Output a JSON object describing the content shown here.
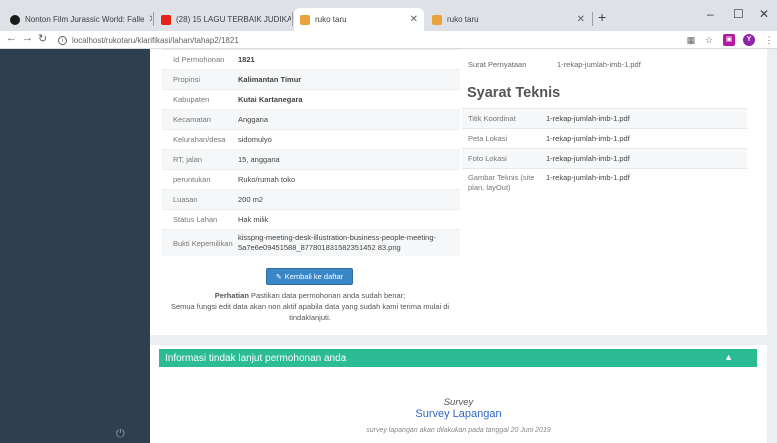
{
  "tabs": [
    {
      "title": "Nonton Film Jurassic World: Falle",
      "color": "#1a1a1a"
    },
    {
      "title": "(28) 15 LAGU TERBAIK JUDIKA",
      "color": "#e62117"
    },
    {
      "title": "ruko taru",
      "color": "#e8a33a"
    },
    {
      "title": "ruko taru",
      "color": "#e8a33a"
    }
  ],
  "window": {
    "new_tab": "+",
    "minimize": "–",
    "maximize": "☐",
    "close": "✕"
  },
  "address": {
    "url": "localhost/rukotaru/klarifikasi/lahan/tahap2/1821"
  },
  "details": [
    {
      "label": "Id Permohonan",
      "value": "1821",
      "bold": true
    },
    {
      "label": "Propinsi",
      "value": "Kalimantan Timur",
      "bold": true
    },
    {
      "label": "Kabupaten",
      "value": "Kutai Kartanegara",
      "bold": true
    },
    {
      "label": "Kecamatan",
      "value": "Anggana"
    },
    {
      "label": "Kelurahan/desa",
      "value": "sidomulyo"
    },
    {
      "label": "RT, jalan",
      "value": "15, anggana"
    },
    {
      "label": "peruntukan",
      "value": "Ruko/rumah toko"
    },
    {
      "label": "Luasan",
      "value": "200 m2"
    },
    {
      "label": "Status Lahan",
      "value": "Hak milik"
    },
    {
      "label": "Bukti Kepemilikan",
      "value": "kisspng-meeting-desk-illustration-business-people-meeting-5a7e6e09451588_877801831582351452 83.png"
    }
  ],
  "surat": {
    "label": "Surat Pernyataan",
    "value": "1-rekap-jumlah-imb-1.pdf"
  },
  "syarat_title": "Syarat Teknis",
  "syarat": [
    {
      "label": "Titik Koordinat",
      "value": "1-rekap-jumlah-imb-1.pdf"
    },
    {
      "label": "Peta Lokasi",
      "value": "1-rekap-jumlah-imb-1.pdf"
    },
    {
      "label": "Foto Lokasi",
      "value": "1-rekap-jumlah-imb-1.pdf"
    },
    {
      "label": "Gambar Teknis (site plan, layOut)",
      "value": "1-rekap-jumlah-imb-1.pdf"
    }
  ],
  "back_button": "Kembali ke daftar",
  "notice": {
    "strong": "Perhatian",
    "text1": " Pastikan data permohonan anda sudah benar;",
    "text2": "Semua fungsi edit data akan non aktif apabila data yang sudah kami terima mulai di tindaklanjuti."
  },
  "followup": {
    "title": "Informasi tindak lanjut permohonan anda",
    "survey_label": "Survey",
    "survey_title": "Survey Lapangan",
    "survey_desc": "survey lapangan akan dilakukan pada tanggal 20 Juni 2019"
  }
}
